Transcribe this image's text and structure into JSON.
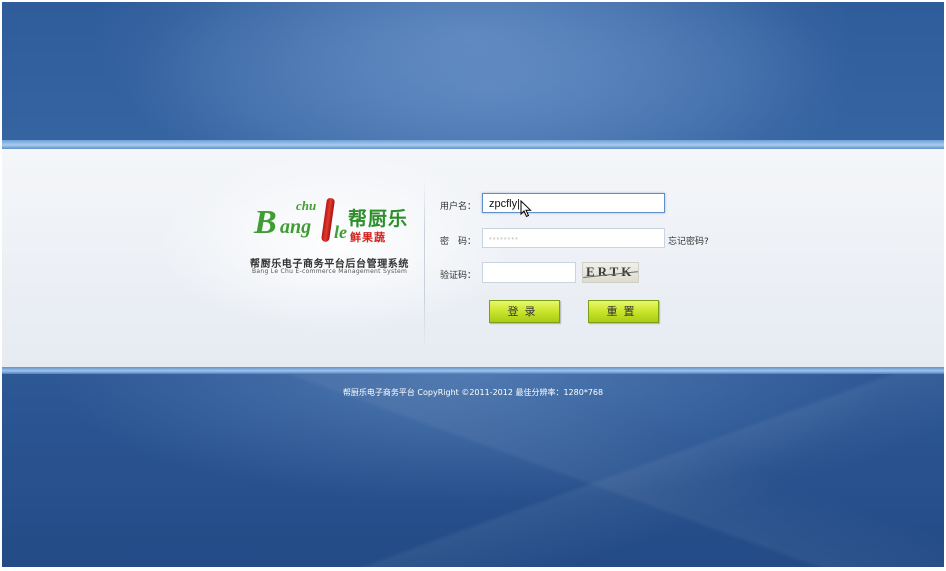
{
  "logo": {
    "latin_b": "B",
    "latin_ang": "ang",
    "latin_chu": "chu",
    "latin_le": "le",
    "chinese_name": "帮厨乐",
    "chinese_sub": "鲜果蔬"
  },
  "system": {
    "title": "帮厨乐电子商务平台后台管理系统",
    "subtitle": "Bang Le Chu E-commerce Management System"
  },
  "form": {
    "username_label": "用户名：",
    "username_value": "zpcfly",
    "password_label": "密　码：",
    "password_mask": "********",
    "forgot_password": "忘记密码?",
    "captcha_label": "验证码：",
    "captcha_value": "",
    "captcha_image_text": "ERTK",
    "login_button": "登录",
    "reset_button": "重置"
  },
  "footer": {
    "text": "帮厨乐电子商务平台 CopyRight ©2011-2012 最佳分辨率：1280*768"
  },
  "colors": {
    "background_blue": "#2f5c9a",
    "band_light": "#eef1f6",
    "button_green": "#c9e42b",
    "logo_green": "#3f9d33",
    "logo_red": "#d2231f"
  }
}
